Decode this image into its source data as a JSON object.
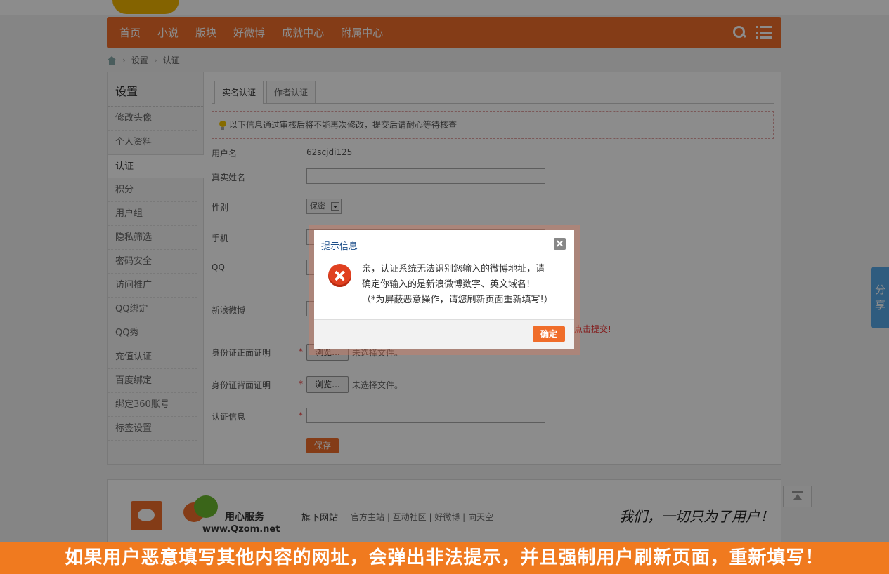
{
  "nav": {
    "items": [
      "首页",
      "小说",
      "版块",
      "好微博",
      "成就中心",
      "附属中心"
    ]
  },
  "breadcrumb": [
    "设置",
    "认证"
  ],
  "sidebar": {
    "title": "设置",
    "items": [
      "修改头像",
      "个人资料",
      "认证",
      "积分",
      "用户组",
      "隐私筛选",
      "密码安全",
      "访问推广",
      "QQ绑定",
      "QQ秀",
      "充值认证",
      "百度绑定",
      "绑定360账号",
      "标签设置"
    ]
  },
  "tabs": [
    "实名认证",
    "作者认证"
  ],
  "notice": "以下信息通过审核后将不能再次修改，提交后请耐心等待核查",
  "form": {
    "username_label": "用户名",
    "username_value": "62scjdi125",
    "realname_label": "真实姓名",
    "gender_label": "性别",
    "gender_value": "保密",
    "phone_label": "手机",
    "qq_label": "QQ",
    "weibo_label": "新浪微博",
    "weibo_hint_tail": "点击提交!",
    "id_front_label": "身份证正面证明",
    "id_back_label": "身份证背面证明",
    "cert_label": "认证信息",
    "required_mark": "*",
    "browse_label": "浏览...",
    "no_file_text": "未选择文件。",
    "save_label": "保存"
  },
  "footer": {
    "brand": "用心服务",
    "url": "www.Qzom.net",
    "sites_title": "旗下网站",
    "links": "官方主站 | 互动社区 | 好微博 | 向天空",
    "slogan": "我们，一切只为了用户！"
  },
  "share_label_1": "分",
  "share_label_2": "享",
  "dialog": {
    "title": "提示信息",
    "line1": "亲，认证系统无法识别您输入的微博地址，请",
    "line2": "确定你输入的是新浪微博数字、英文域名!",
    "line3": "（*为屏蔽恶意操作，请您刷新页面重新填写!）",
    "ok_label": "确定"
  },
  "banner": "如果用户恶意填写其他内容的网址，会弹出非法提示，并且强制用户刷新页面，重新填写！",
  "colors": {
    "accent": "#f06d2a",
    "dialog_title": "#1d4f8a",
    "share": "#57a8e8"
  }
}
